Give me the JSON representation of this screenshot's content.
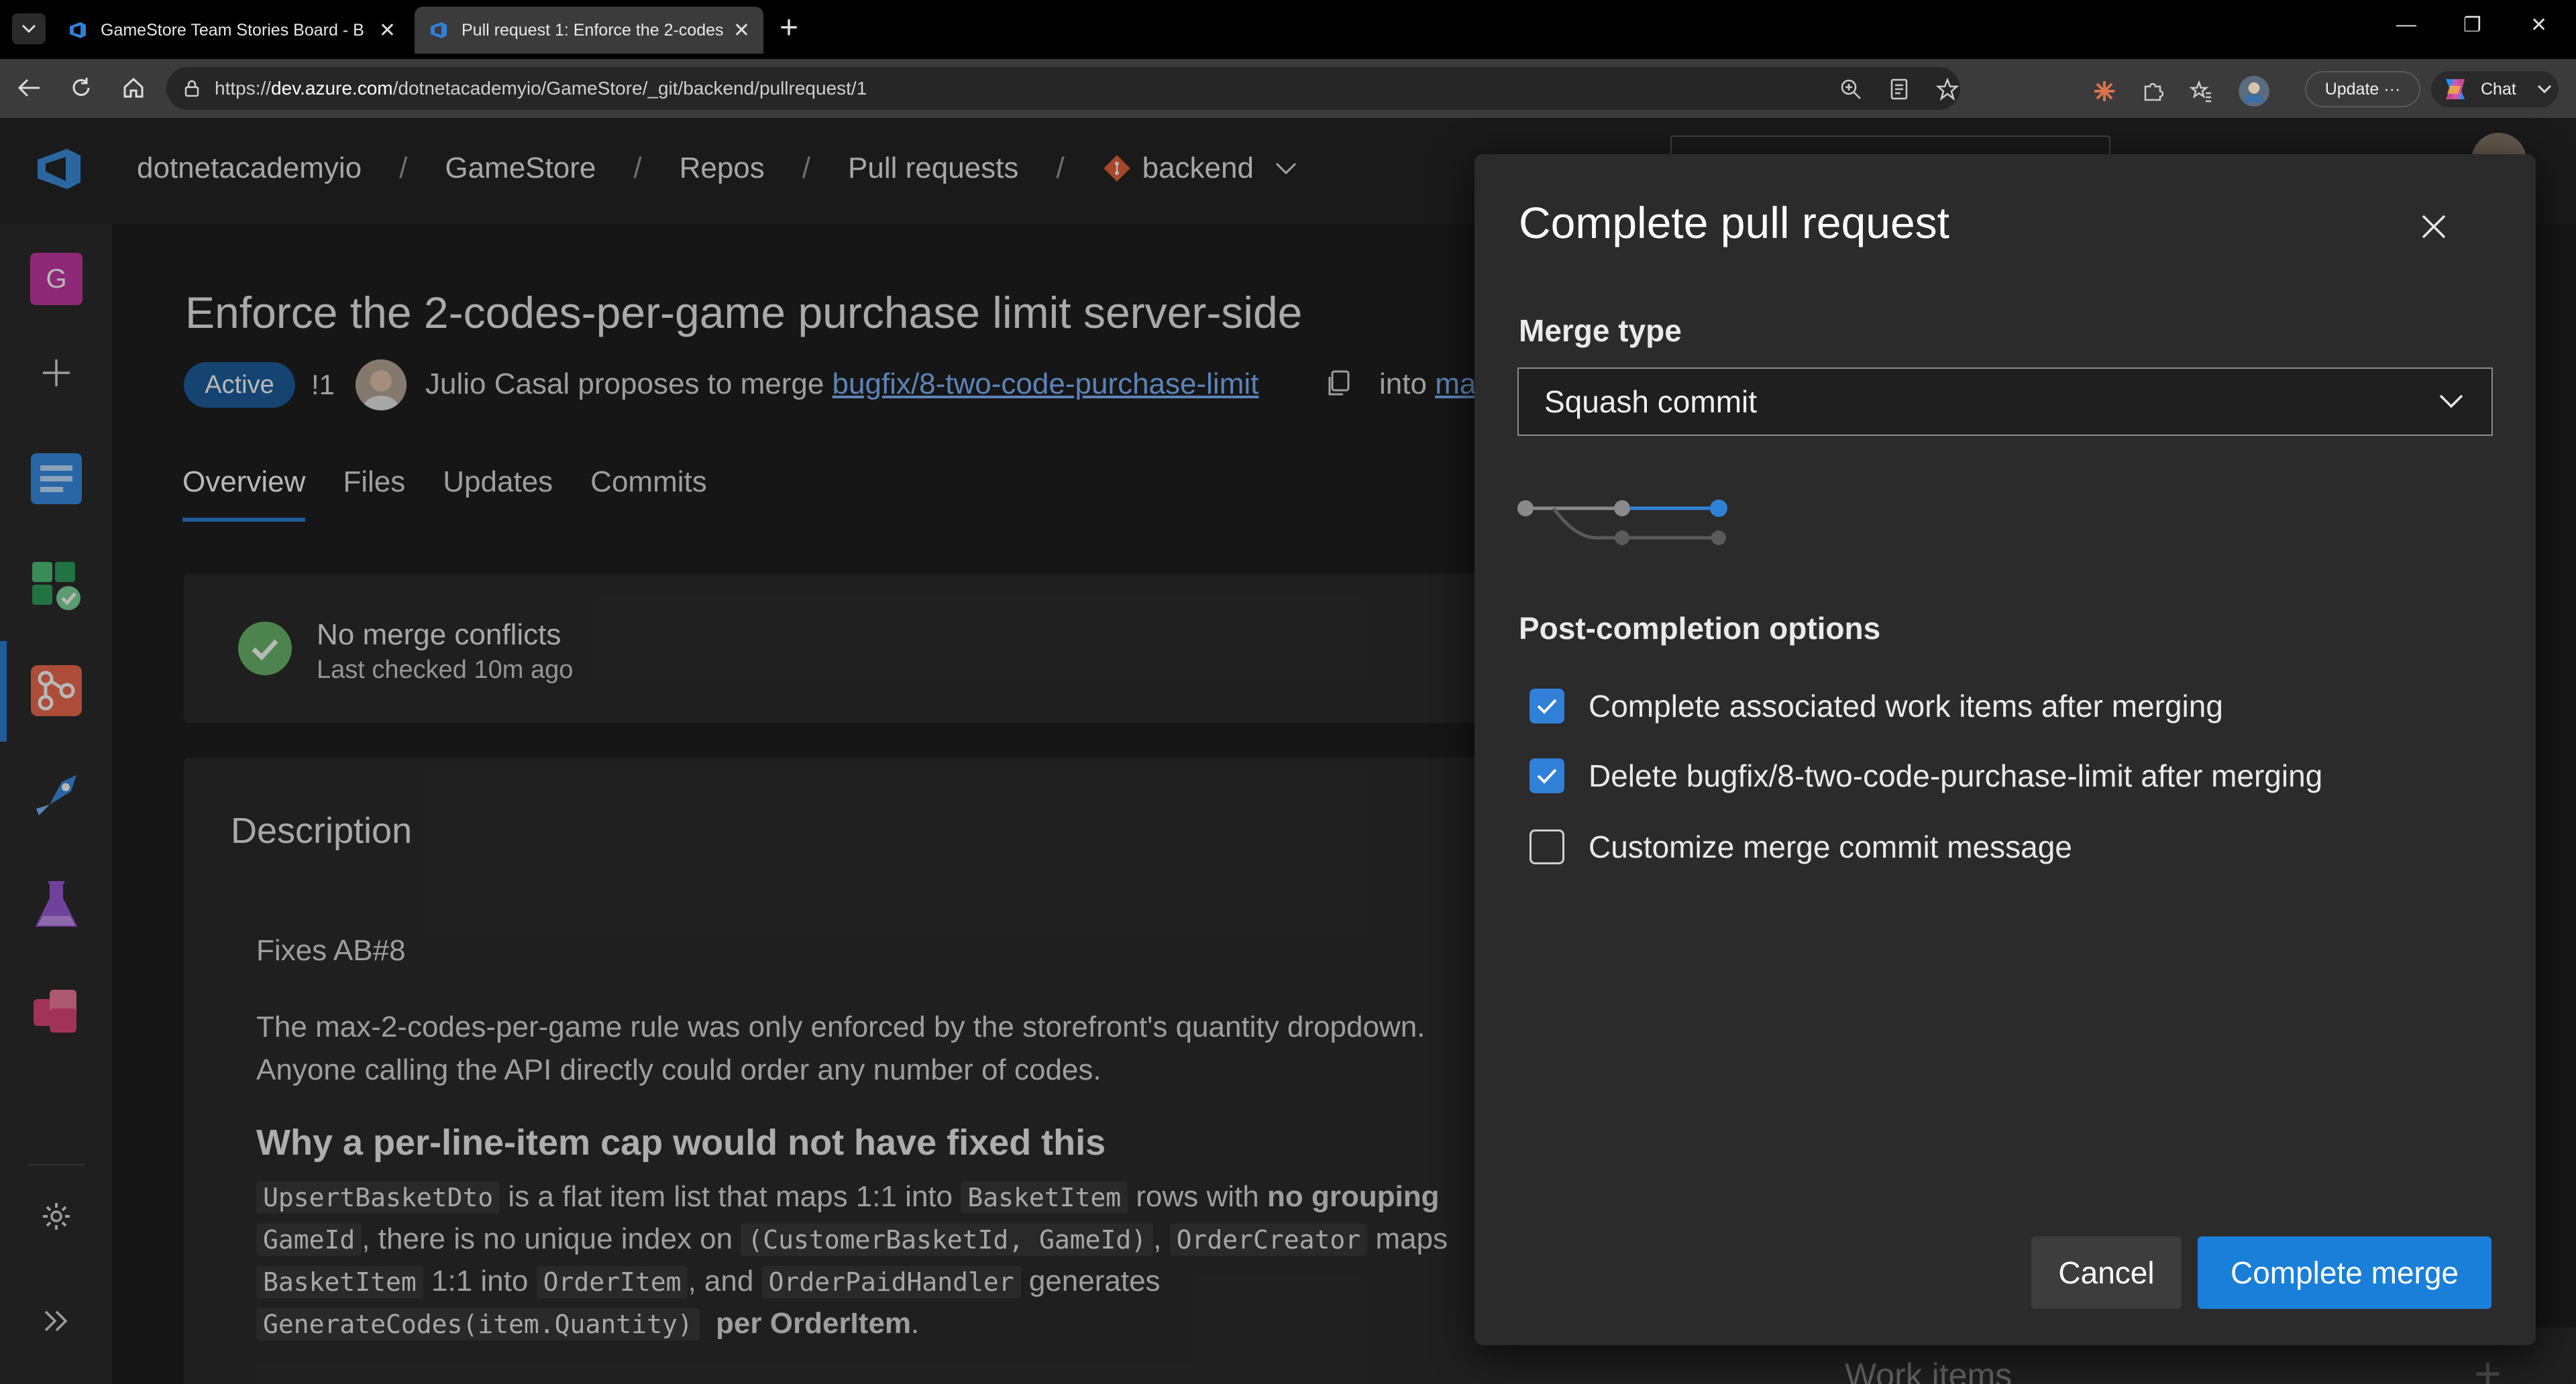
{
  "browser": {
    "tabs": [
      {
        "title": "GameStore Team Stories Board - B",
        "active": false
      },
      {
        "title": "Pull request 1: Enforce the 2-codes",
        "active": true
      }
    ],
    "url_prefix": "https://",
    "url_host": "dev.azure.com",
    "url_path": "/dotnetacademyio/GameStore/_git/backend/pullrequest/1",
    "update_label": "Update",
    "update_more": "···",
    "chat_label": "Chat"
  },
  "breadcrumb": {
    "org": "dotnetacademyio",
    "project": "GameStore",
    "repos": "Repos",
    "pull_requests": "Pull requests",
    "repo": "backend",
    "separator": "/"
  },
  "sidebar": {
    "project_initial": "G",
    "items": [
      "add",
      "overview",
      "boards",
      "repos",
      "pipelines",
      "test-plans",
      "artifacts",
      "settings",
      "expand"
    ]
  },
  "pr": {
    "title": "Enforce the 2-codes-per-game purchase limit server-side",
    "status": "Active",
    "id": "!1",
    "author_text": "Julio Casal proposes to merge",
    "source_branch": "bugfix/8-two-code-purchase-limit",
    "into_text": "into",
    "target_branch": "main",
    "tabs": [
      "Overview",
      "Files",
      "Updates",
      "Commits"
    ]
  },
  "merge_status": {
    "title": "No merge conflicts",
    "subtitle": "Last checked 10m ago"
  },
  "description": {
    "heading": "Description",
    "line1": "Fixes AB#8",
    "para1_l1": "The max-2-codes-per-game rule was only enforced by the storefront's quantity dropdown.",
    "para1_l2": "Anyone calling the API directly could order any number of codes.",
    "h3": "Why a per-line-item cap would not have fixed this",
    "code1": "UpsertBasketDto",
    "t1": " is a flat item list that maps 1:1 into ",
    "code2": "BasketItem",
    "t2": " rows with ",
    "bold1": "no grouping",
    "code3": "GameId",
    "t3": ", there is no unique index on ",
    "code4": "(CustomerBasketId, GameId)",
    "t4": ", ",
    "code5": "OrderCreator",
    "t5": " maps",
    "code6": "BasketItem",
    "t6": " 1:1 into ",
    "code7": "OrderItem",
    "t7": ", and ",
    "code8": "OrderPaidHandler",
    "t8": " generates",
    "code9": "GenerateCodes(item.Quantity)",
    "bold2": "per OrderItem",
    "t9": "."
  },
  "work_items": {
    "label": "Work items"
  },
  "dialog": {
    "title": "Complete pull request",
    "merge_type_label": "Merge type",
    "merge_type_value": "Squash commit",
    "post_completion_label": "Post-completion options",
    "options": [
      {
        "label": "Complete associated work items after merging",
        "checked": true
      },
      {
        "label": "Delete bugfix/8-two-code-purchase-limit after merging",
        "checked": true
      },
      {
        "label": "Customize merge commit message",
        "checked": false
      }
    ],
    "cancel_label": "Cancel",
    "complete_label": "Complete merge"
  },
  "colors": {
    "accent": "#2f80d6",
    "primary_button": "#1a7fd8",
    "success": "#6bb86b",
    "link": "#7eb7ff"
  }
}
